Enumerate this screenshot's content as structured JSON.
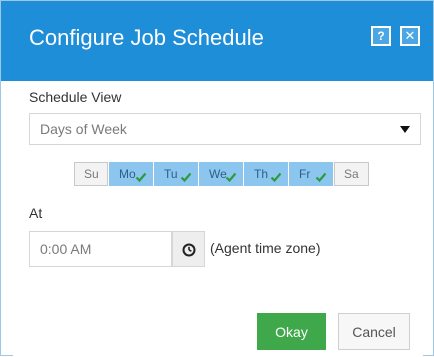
{
  "dialog": {
    "title": "Configure Job Schedule",
    "help_icon": "help-icon",
    "close_icon": "close-icon",
    "help_glyph": "?",
    "close_glyph": "✕"
  },
  "schedule_view": {
    "label": "Schedule View",
    "selected": "Days of Week"
  },
  "days": [
    {
      "label": "Su",
      "checked": false
    },
    {
      "label": "Mo",
      "checked": true
    },
    {
      "label": "Tu",
      "checked": true
    },
    {
      "label": "We",
      "checked": true
    },
    {
      "label": "Th",
      "checked": true
    },
    {
      "label": "Fr",
      "checked": true
    },
    {
      "label": "Sa",
      "checked": false
    }
  ],
  "at": {
    "label": "At",
    "time": "0:00 AM",
    "clock_icon": "clock-icon",
    "timezone_note": "(Agent time zone)"
  },
  "buttons": {
    "okay": "Okay",
    "cancel": "Cancel"
  },
  "colors": {
    "titlebar": "#1e8ed9",
    "selected_day": "#8cc6ee",
    "check": "#2e9a3e",
    "okay": "#3ea84a"
  }
}
